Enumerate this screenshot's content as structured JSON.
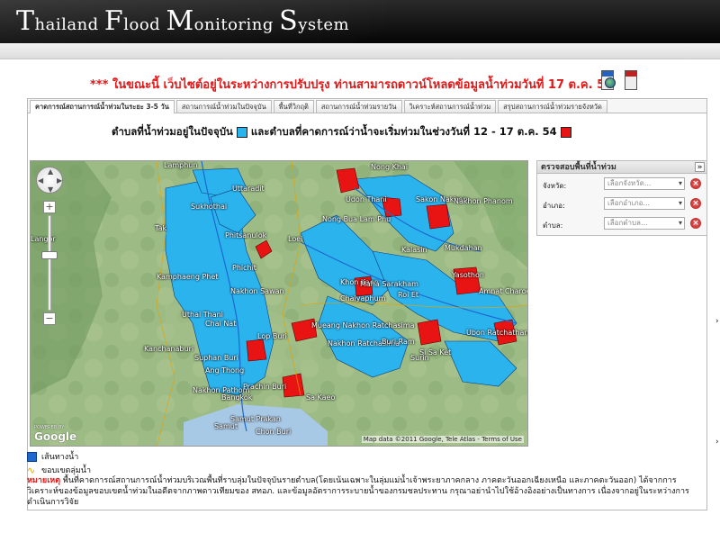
{
  "header": {
    "title_parts": [
      {
        "cap": "T",
        "rest": "hailand "
      },
      {
        "cap": "F",
        "rest": "lood "
      },
      {
        "cap": "M",
        "rest": "onitoring "
      },
      {
        "cap": "S",
        "rest": "ystem"
      }
    ]
  },
  "notice": "*** ในขณะนี้ เว็บไซต์อยู่ในระหว่างการปรับปรุง ท่านสามารถดาวน์โหลดข้อมูลน้ำท่วมวันที่ 17 ต.ค. 54 ได้ที่นี่",
  "tabs": [
    {
      "label": "คาดการณ์สถานการณ์น้ำท่วมในระยะ 3-5 วัน",
      "active": true
    },
    {
      "label": "สถานการณ์น้ำท่วมในปัจจุบัน",
      "active": false
    },
    {
      "label": "พื้นที่วิกฤติ",
      "active": false
    },
    {
      "label": "สถานการณ์น้ำท่วมรายวัน",
      "active": false
    },
    {
      "label": "วิเคราะห์สถานการณ์น้ำท่วม",
      "active": false
    },
    {
      "label": "สรุปสถานการณ์น้ำท่วมรายจังหวัด",
      "active": false
    }
  ],
  "legend": {
    "current_label": "ตำบลที่น้ำท่วมอยู่ในปัจจุบัน",
    "current_color": "#2bb3ee",
    "forecast_label": "และตำบลที่คาดการณ์ว่าน้ำจะเริ่มท่วมในช่วงวันที่ 12 - 17 ต.ค. 54",
    "forecast_color": "#e81414"
  },
  "map": {
    "places": [
      "Lamphun",
      "Nong Khai",
      "Udon Thani",
      "Sakon Nakhon",
      "Nakhon Phanom",
      "Uttaradit",
      "Sukhothai",
      "Nong Bua Lam Phu",
      "Phitsanulok",
      "Tak",
      "Loei",
      "Kalasin",
      "Mukdahan",
      "Kamphaeng Phet",
      "Phichit",
      "Khon Kaen",
      "Yasothon",
      "Maha Sarakham",
      "Roi Et",
      "Amnat Charoen",
      "Nakhon Sawan",
      "Chaiyaphum",
      "Uthai Thani",
      "Chai Nat",
      "Mueang Nakhon Ratchasima",
      "Ubon Ratchathani",
      "Lop Buri",
      "Nakhon Ratchasima",
      "Buri Ram",
      "Si Sa Ket",
      "Kanchanaburi",
      "Suphan Buri",
      "Ang Thong",
      "Nakhon Pathom",
      "Bangkok",
      "Prachin Buri",
      "Sa Kaeo",
      "Samut Prakan",
      "Chon Buri",
      "Samut",
      "Langor",
      "Surin"
    ],
    "google": "Google",
    "powered_by": "POWERED BY",
    "attribution": "Map data ©2011 Google, Tele Atlas - Terms of Use"
  },
  "search_panel": {
    "title": "ตรวจสอบพื้นที่น้ำท่วม",
    "collapse": "»",
    "fields": [
      {
        "label": "จังหวัด:",
        "placeholder": "เลือกจังหวัด..."
      },
      {
        "label": "อำเภอ:",
        "placeholder": "เลือกอำเภอ..."
      },
      {
        "label": "ตำบล:",
        "placeholder": "เลือกตำบล..."
      }
    ],
    "clear": "×"
  },
  "bottom": {
    "river_label": "เส้นทางน้ำ",
    "basin_label": "ขอบเขตลุ่มน้ำ",
    "remark_title": "หมายเหตุ",
    "remark_text": " พื้นที่คาดการณ์สถานการณ์น้ำท่วมบริเวณพื้นที่ราบลุ่มในปัจจุบันรายตำบล(โดยเน้นเฉพาะในลุ่มแม่น้ำเจ้าพระยาภาคกลาง ภาคตะวันออกเฉียงเหนือ และภาคตะวันออก) ได้จากการวิเคราะห์ของข้อมูลขอบเขตน้ำท่วมในอดีตจากภาพดาวเทียมของ สทอภ. และข้อมูลอัตราการระบายน้ำของกรมชลประทาน กรุณาอย่านำไปใช้อ้างอิงอย่างเป็นทางการ เนื่องจากอยู่ในระหว่างการดำเนินการวิจัย",
    "side_marks": [
      "›",
      "›"
    ]
  }
}
